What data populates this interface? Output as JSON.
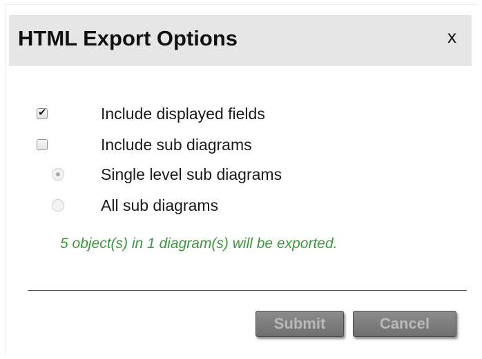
{
  "dialog": {
    "title": "HTML Export Options",
    "close_label": "x"
  },
  "options": {
    "include_displayed_fields": {
      "label": "Include displayed fields",
      "checked": true
    },
    "include_sub_diagrams": {
      "label": "Include sub diagrams",
      "checked": false
    },
    "single_level_sub_diagrams": {
      "label": "Single level sub diagrams",
      "selected": true,
      "disabled": true
    },
    "all_sub_diagrams": {
      "label": "All sub diagrams",
      "selected": false,
      "disabled": true
    }
  },
  "summary": "5 object(s) in 1 diagram(s) will be exported.",
  "buttons": {
    "submit_label": "Submit",
    "cancel_label": "Cancel"
  },
  "colors": {
    "header_background": "#e6e6e6",
    "summary_text": "#3a9a3a",
    "button_background": "#7d7d7d",
    "button_text": "#b9b9b9"
  }
}
